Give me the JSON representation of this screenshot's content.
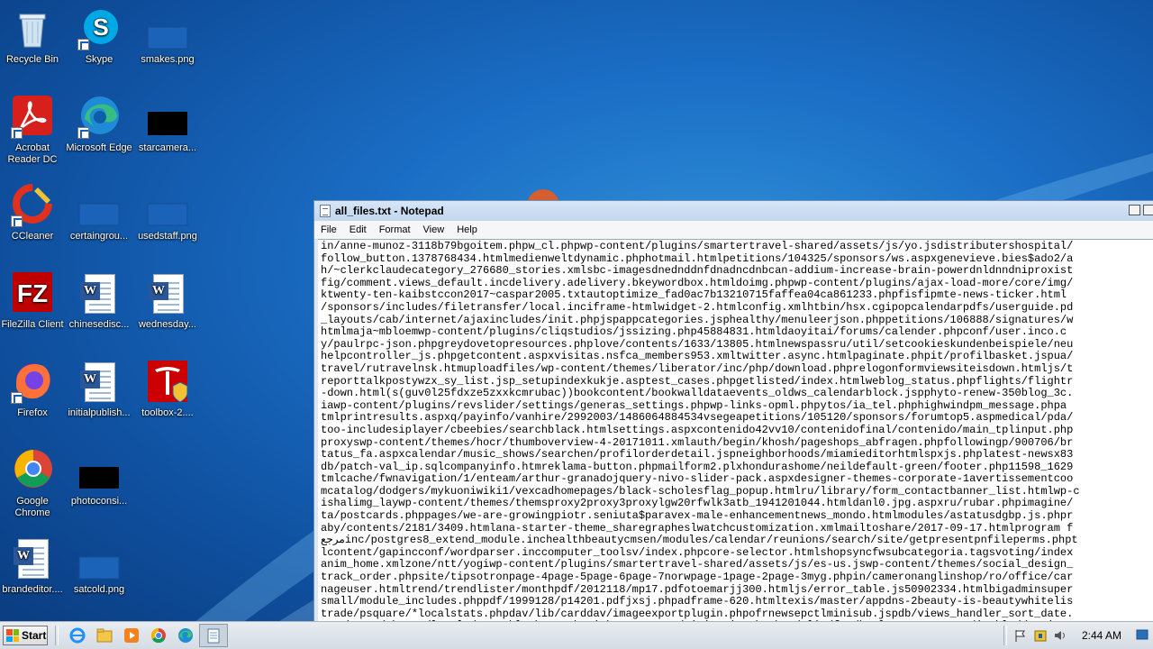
{
  "desktop_icons": [
    {
      "label": "Recycle Bin"
    },
    {
      "label": "Skype"
    },
    {
      "label": "smakes.png"
    },
    {
      "label": "Acrobat Reader DC"
    },
    {
      "label": "Microsoft Edge"
    },
    {
      "label": "starcamera..."
    },
    {
      "label": "CCleaner"
    },
    {
      "label": "certaingrou..."
    },
    {
      "label": "usedstaff.png"
    },
    {
      "label": "FileZilla Client"
    },
    {
      "label": "chinesedisc..."
    },
    {
      "label": "wednesday..."
    },
    {
      "label": "Firefox"
    },
    {
      "label": "initialpublish..."
    },
    {
      "label": "toolbox-2...."
    },
    {
      "label": "Google Chrome"
    },
    {
      "label": "photoconsi..."
    },
    {
      "label": "brandeditor...."
    },
    {
      "label": "satcold.png"
    }
  ],
  "notepad": {
    "title": "all_files.txt - Notepad",
    "menu": [
      "File",
      "Edit",
      "Format",
      "View",
      "Help"
    ],
    "lines": [
      "in/anne-munoz-3118b79bgoitem.phpw_cl.phpwp-content/plugins/smartertravel-shared/assets/js/yo.jsdistributershospital/",
      "follow_button.1378768434.htmlmedienweltdynamic.phphotmail.htmlpetitions/104325/sponsors/ws.aspxgenevieve.bies$ado2/a",
      "h/~clerkclaudecategory_276680_stories.xmlsbc-imagesdnednddnfdnadncdnbcan-addium-increase-brain-powerdnldnndniproxist",
      "fig/comment.views_default.incdelivery.adelivery.bkeywordbox.htmldoimg.phpwp-content/plugins/ajax-load-more/core/img/",
      "ktwenty-ten-kaibstccon2017~caspar2005.txtautoptimize_fad0ac7b13210715faffea04ca861233.phpfisfipmte-news-ticker.html",
      "/sponsors/includes/filetransfer/local.inciframe-htmlwidget-2.htmlconfig.xmlhtbin/hsx.cgipopcalendarpdfs/userguide.pd",
      "_layouts/cab/internet/ajaxincludes/init.phpjspappcategories.jsphealthy/menuleerjson.phppetitions/106888/signatures/w",
      "htmlmaja~mbloemwp-content/plugins/cliqstudios/jssizing.php45884831.htmldaoyitai/forums/calender.phpconf/user.inco.c",
      "y/paulrpc-json.phpgreydovetopresources.phplove/contents/1633/13805.htmlnewspassru/util/setcookieskundenbeispiele/neu",
      "helpcontroller_js.phpgetcontent.aspxvisitas.nsfca_members953.xmltwitter.async.htmlpaginate.phpit/profilbasket.jspua/",
      "travel/rutravelnsk.htmuploadfiles/wp-content/themes/liberator/inc/php/download.phprelogonformviewsiteisdown.htmljs/t",
      "reporttalkpostywzx_sy_list.jsp_setupindexkukje.asptest_cases.phpgetlisted/index.htmlweblog_status.phpflights/flightr",
      "-down.html(s(guv0l25fdxze5zxxkcmrubac))bookcontent/bookwalldataevents_oldws_calendarblock.jspphyto-renew-350blog_3c.",
      "iawp-content/plugins/revslider/settings/generas_settings.phpwp-links-opml.phpytos/ia_tel.phphighwindpm_message.phpa",
      "tmlprintresults.aspxq/payinfo/vanhire/2992003/1486064884534vsegeapetitions/105120/sponsors/forumtop5.aspmedical/pda/",
      "too-includesiplayer/cbeebies/searchblack.htmlsettings.aspxcontenido42vv10/contenidofinal/contenido/main_tplinput.php",
      "proxyswp-content/themes/hocr/thumboverview-4-20171011.xmlauth/begin/khosh/pageshops_abfragen.phpfollowingp/900706/br",
      "tatus_fa.aspxcalendar/music_shows/searchen/profilorderdetail.jspneighborhoods/miamieditorhtmlspxjs.phplatest-newsx83",
      "db/patch-val_ip.sqlcompanyinfo.htmreklama-button.phpmailform2.plxhondurashome/neildefault-green/footer.php11598_1629",
      "tmlcache/fwnavigation/1/enteam/arthur-granadojquery-nivo-slider-pack.aspxdesigner-themes-corporate-1avertissementcoo",
      "mcatalog/dodgers/mykuoniwiki1/vexcadhomepages/black-scholesflag_popup.htmlru/library/form_contactbanner_list.htmlwp-c",
      "ishalimg_laywp-content/themes/themsproxy2proxy3proxylgw20rfwlk3atb_1941201044.htmldanl0.jpg.aspxru/rubar.phpimagine/",
      "ta/postcards.phppages/we-are-growingpiotr.seniuta$paravex-male-enhancementnews_mondo.htmlmodules/astatusdgbp.js.phpr",
      "aby/contents/2181/3409.htmlana-starter-theme_sharegrapheslwatchcustomization.xmlmailtoshare/2017-09-17.htmlprogram f",
      "مرجعinc/postgres8_extend_module.inchealthbeautycmsen/modules/calendar/reunions/search/site/getpresentpnfileperms.phpt",
      "lcontent/gapincconf/wordparser.inccomputer_toolsv/index.phpcore-selector.htmlshopsyncfwsubcategoria.tagsvoting/index",
      "anim_home.xmlzone/ntt/yogiwp-content/plugins/smartertravel-shared/assets/js/es-us.jswp-content/themes/social_design_",
      "track_order.phpsite/tipsotronpage-4page-5page-6page-7norwpage-1page-2page-3myg.phpin/cameronanglinshop/ro/office/car",
      "nageuser.htmltrend/trendlister/monthpdf/2012118/mp17.pdfotoemarjj300.htmljs/error_table.js50902334.htmlbigadminsuper",
      "small/module_includes.phppdf/1999128/p14201.pdfjxsj.phpadframe-620.htmltexis/master/appdns-2beauty-is-beautywhitelis",
      "trade/psquare/*localstats.phpdav/lib/carddav/imageexportplugin.phpofrnewsepctlminisub.jspdb/views_handler_sort_date.",
      "merchant2/themes/levels/cssweblo_home.phptieksxterranea/visitapitusharbandalin/faq/html01.aspteaser.disabled/scripts",
      "age/countrys/africa/eritrea/ertravel/mahapolice/jsp/temp~edibabycenteres~ede~eddtabid/6668/~edazanox.htmlsbbmr00001e"
    ]
  },
  "taskbar": {
    "start_label": "Start",
    "clock": "2:44 AM"
  },
  "colors": {
    "desktop_blue": "#1a6dc4",
    "title_bar": "#c2d6ef",
    "taskbar": "#dce3ea"
  }
}
